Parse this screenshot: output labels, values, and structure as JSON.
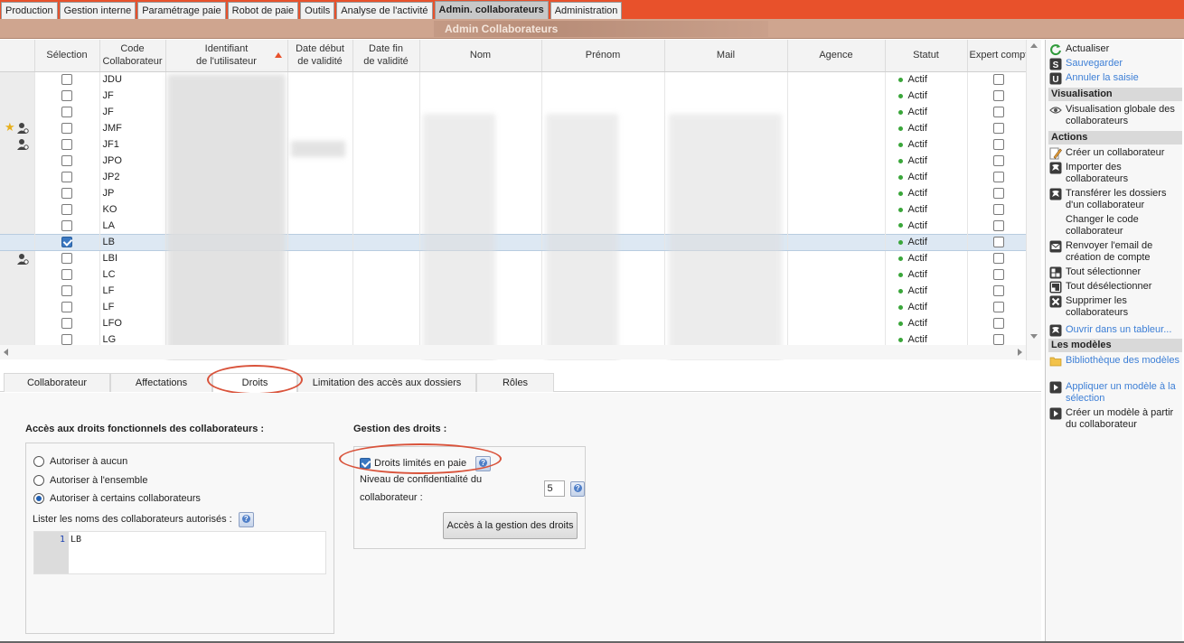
{
  "top_tabs": [
    {
      "label": "Production",
      "active": false
    },
    {
      "label": "Gestion interne",
      "active": false
    },
    {
      "label": "Paramétrage paie",
      "active": false
    },
    {
      "label": "Robot de paie",
      "active": false
    },
    {
      "label": "Outils",
      "active": false
    },
    {
      "label": "Analyse de l'activité",
      "active": false
    },
    {
      "label": "Admin. collaborateurs",
      "active": true
    },
    {
      "label": "Administration",
      "active": false
    }
  ],
  "page_title": "Admin Collaborateurs",
  "grid": {
    "columns": {
      "selection": "Sélection",
      "code": "Code\nCollaborateur",
      "identifiant": "Identifiant\nde l'utilisateur",
      "date_debut": "Date début\nde validité",
      "date_fin": "Date fin\nde validité",
      "nom": "Nom",
      "prenom": "Prénom",
      "mail": "Mail",
      "agence": "Agence",
      "statut": "Statut",
      "expert": "Expert compt"
    },
    "rows": [
      {
        "code": "JDU",
        "status": "Actif",
        "selected": false
      },
      {
        "code": "JF",
        "status": "Actif",
        "selected": false
      },
      {
        "code": "JF",
        "status": "Actif",
        "selected": false
      },
      {
        "code": "JMF",
        "status": "Actif",
        "selected": false
      },
      {
        "code": "JF1",
        "status": "Actif",
        "selected": false
      },
      {
        "code": "JPO",
        "status": "Actif",
        "selected": false
      },
      {
        "code": "JP2",
        "status": "Actif",
        "selected": false
      },
      {
        "code": "JP",
        "status": "Actif",
        "selected": false
      },
      {
        "code": "KO",
        "status": "Actif",
        "selected": false
      },
      {
        "code": "LA",
        "status": "Actif",
        "selected": false
      },
      {
        "code": "LB",
        "status": "Actif",
        "selected": true
      },
      {
        "code": "LBI",
        "status": "Actif",
        "selected": false
      },
      {
        "code": "LC",
        "status": "Actif",
        "selected": false
      },
      {
        "code": "LF",
        "status": "Actif",
        "selected": false
      },
      {
        "code": "LF",
        "status": "Actif",
        "selected": false
      },
      {
        "code": "LFO",
        "status": "Actif",
        "selected": false
      },
      {
        "code": "LG",
        "status": "Actif",
        "selected": false
      }
    ]
  },
  "sub_tabs": [
    {
      "label": "Collaborateur",
      "active": false
    },
    {
      "label": "Affectations",
      "active": false
    },
    {
      "label": "Droits",
      "active": true
    },
    {
      "label": "Limitation des accès aux dossiers",
      "active": false
    },
    {
      "label": "Rôles",
      "active": false
    }
  ],
  "droits": {
    "access_title": "Accès aux droits fonctionnels des collaborateurs :",
    "radio_options": [
      {
        "label": "Autoriser à aucun",
        "checked": false
      },
      {
        "label": "Autoriser à l'ensemble",
        "checked": false
      },
      {
        "label": "Autoriser à certains collaborateurs",
        "checked": true
      }
    ],
    "list_label": "Lister les noms des collaborateurs autorisés :",
    "editor_line_number": "1",
    "editor_content": "LB",
    "gestion_title": "Gestion des droits :",
    "droits_limites_label": "Droits limités en paie",
    "droits_limites_checked": true,
    "confidentiality_label": "Niveau de confidentialité du collaborateur :",
    "confidentiality_value": "5",
    "access_button": "Accès à la gestion des droits"
  },
  "sidebar": {
    "actualiser": "Actualiser",
    "sauvegarder": "Sauvegarder",
    "annuler": "Annuler la saisie",
    "visualisation_header": "Visualisation",
    "visualisation_globale": "Visualisation globale des collaborateurs",
    "actions_header": "Actions",
    "creer": "Créer un collaborateur",
    "importer": "Importer des collaborateurs",
    "transferer": "Transférer les dossiers d'un collaborateur",
    "changer_code": "Changer le code collaborateur",
    "renvoyer": "Renvoyer l'email de création de compte",
    "tout_selectionner": "Tout sélectionner",
    "tout_deselectionner": "Tout désélectionner",
    "supprimer": "Supprimer les collaborateurs",
    "ouvrir_tableur": "Ouvrir dans un tableur...",
    "modeles_header": "Les modèles",
    "bibliotheque": "Bibliothèque des modèles",
    "appliquer": "Appliquer un modèle à la sélection",
    "creer_modele": "Créer un modèle à partir du collaborateur"
  },
  "colors": {
    "accent_orange": "#e8512b",
    "title_bar": "#cfa58f",
    "link_blue": "#3d7fd6",
    "status_green": "#3aa63a",
    "highlight_red": "#d9533b"
  }
}
